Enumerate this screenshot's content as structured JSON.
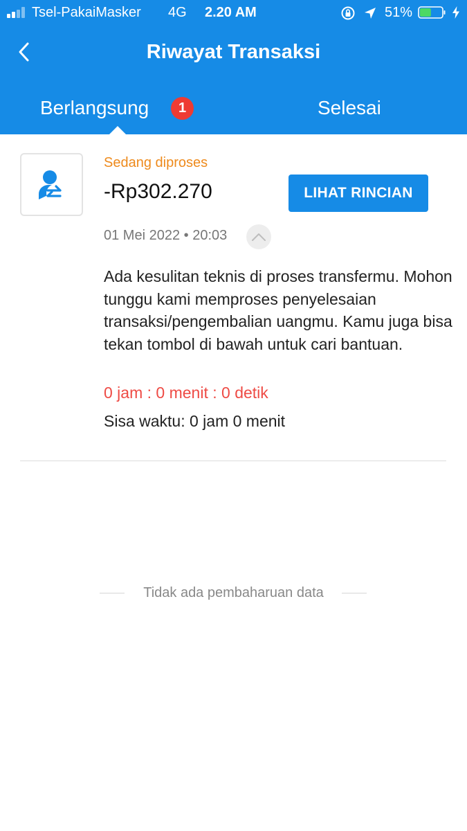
{
  "status_bar": {
    "carrier": "Tsel-PakaiMasker",
    "network": "4G",
    "time": "2.20 AM",
    "battery": "51%",
    "battery_level": 0.51,
    "signal_bars_filled": 2,
    "signal_bars_total": 4
  },
  "header": {
    "title": "Riwayat Transaksi",
    "background_color": "#168BE6"
  },
  "tabs": [
    {
      "label": "Berlangsung",
      "badge": "1",
      "active": true
    },
    {
      "label": "Selesai",
      "active": false
    }
  ],
  "transaction": {
    "icon": "user-transfer-icon",
    "status": "Sedang diproses",
    "status_color": "#EE8A1C",
    "amount": "-Rp302.270",
    "detail_button": "LIHAT RINCIAN",
    "datetime": "01 Mei 2022 • 20:03",
    "message": "Ada kesulitan teknis di proses transfermu. Mohon tunggu kami memproses penyelesaian transaksi/pengembalian uangmu. Kamu juga bisa tekan tombol di bawah untuk cari bantuan.",
    "countdown": "0 jam : 0 menit : 0 detik",
    "countdown_color": "#EE4B45",
    "remaining": "Sisa waktu: 0 jam 0 menit"
  },
  "footer_note": "Tidak ada pembaharuan data"
}
